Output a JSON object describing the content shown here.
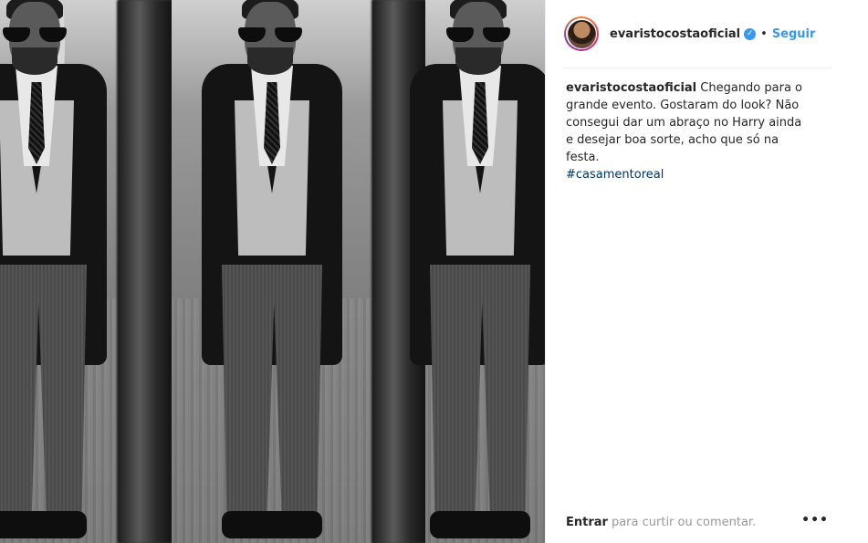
{
  "post": {
    "username": "evaristocostaoficial",
    "verified_glyph": "✓",
    "separator": "•",
    "follow_label": "Seguir",
    "caption_user": "evaristocostaoficial",
    "caption_text": "Chegando para o grande evento. Gostaram do look? Não consegui dar um abraço no Harry ainda e desejar boa sorte, acho que só na festa.",
    "hashtag": "#casamentoreal",
    "footer_login": "Entrar",
    "footer_text": "para curtir ou comentar.",
    "more_glyph": "•••"
  },
  "colors": {
    "link": "#3897f0",
    "hashtag": "#003569",
    "text": "#262626"
  },
  "icons": {
    "verified": "verified-badge-icon",
    "more": "more-options-icon"
  }
}
